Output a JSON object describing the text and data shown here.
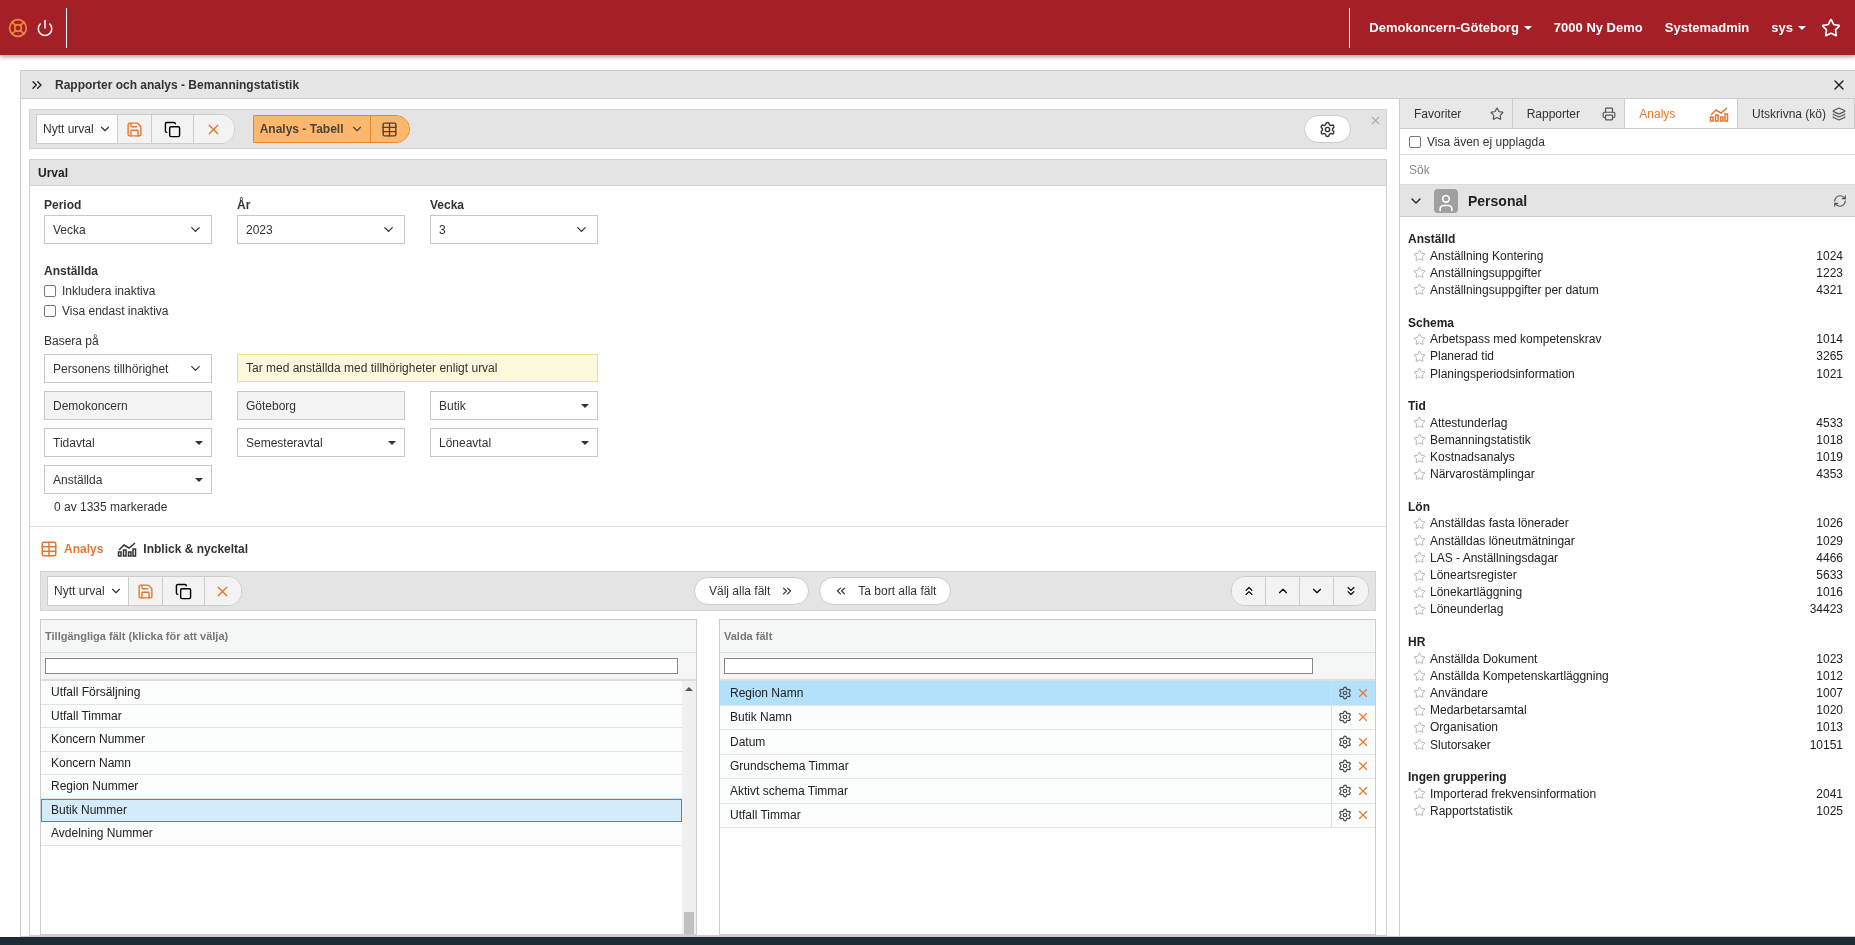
{
  "top_bar": {
    "org_menu": "Demokoncern-Göteborg",
    "company": "7000 Ny Demo",
    "role": "Systemadmin",
    "user_menu": "sys"
  },
  "window": {
    "title": "Rapporter och analys - Bemanningstatistik"
  },
  "toolbar": {
    "selection": "Nytt urval",
    "view_mode": "Analys - Tabell"
  },
  "urval": {
    "title": "Urval",
    "selects": [
      {
        "label": "Period",
        "value": "Vecka"
      },
      {
        "label": "År",
        "value": "2023"
      },
      {
        "label": "Vecka",
        "value": "3"
      }
    ],
    "employees_label": "Anställda",
    "checkboxes": [
      {
        "label": "Inkludera inaktiva",
        "checked": false
      },
      {
        "label": "Visa endast inaktiva",
        "checked": false
      }
    ],
    "base_label": "Basera på",
    "base_value": "Personens tillhörighet",
    "base_hint": "Tar med anställda med tillhörigheter enligt urval",
    "filters": [
      {
        "kind": "readonly",
        "value": "Demokoncern"
      },
      {
        "kind": "readonly",
        "value": "Göteborg"
      },
      {
        "kind": "dropdown",
        "value": "Butik"
      },
      {
        "kind": "dropdown",
        "value": "Tidavtal"
      },
      {
        "kind": "dropdown",
        "value": "Semesteravtal"
      },
      {
        "kind": "dropdown",
        "value": "Löneavtal"
      },
      {
        "kind": "dropdown",
        "value": "Anställda"
      }
    ],
    "selected_count": "0 av 1335 markerade"
  },
  "analysis_tabs": [
    {
      "label": "Analys",
      "selected": true
    },
    {
      "label": "Inblick & nyckeltal",
      "selected": false
    }
  ],
  "field_toolbar": {
    "selection": "Nytt urval",
    "select_all": "Välj alla fält",
    "remove_all": "Ta bort alla fält"
  },
  "available_fields": {
    "header": "Tillgängliga fält (klicka för att välja)",
    "rows": [
      {
        "label": "Utfall Försäljning",
        "selected": false
      },
      {
        "label": "Utfall Timmar",
        "selected": false
      },
      {
        "label": "Koncern Nummer",
        "selected": false
      },
      {
        "label": "Koncern Namn",
        "selected": false
      },
      {
        "label": "Region Nummer",
        "selected": false
      },
      {
        "label": "Butik Nummer",
        "selected": true
      },
      {
        "label": "Avdelning Nummer",
        "selected": false
      }
    ]
  },
  "chosen_fields": {
    "header": "Valda fält",
    "rows": [
      {
        "label": "Region Namn",
        "selected": true
      },
      {
        "label": "Butik Namn",
        "selected": false
      },
      {
        "label": "Datum",
        "selected": false
      },
      {
        "label": "Grundschema Timmar",
        "selected": false
      },
      {
        "label": "Aktivt schema Timmar",
        "selected": false
      },
      {
        "label": "Utfall Timmar",
        "selected": false
      }
    ]
  },
  "side_panel": {
    "tabs": [
      {
        "label": "Favoriter",
        "selected": false
      },
      {
        "label": "Rapporter",
        "selected": false
      },
      {
        "label": "Analys",
        "selected": true
      },
      {
        "label": "Utskrivna (kö)",
        "selected": false
      }
    ],
    "show_unregistered": {
      "label": "Visa även ej upplagda",
      "checked": false
    },
    "search": {
      "placeholder": "Sök"
    },
    "group": {
      "title": "Personal",
      "expanded": true
    },
    "sections": [
      {
        "title": "Anställd",
        "items": [
          {
            "name": "Anställning Kontering",
            "number": "1024"
          },
          {
            "name": "Anställningsuppgifter",
            "number": "1223"
          },
          {
            "name": "Anställningsuppgifter per datum",
            "number": "4321"
          }
        ]
      },
      {
        "title": "Schema",
        "items": [
          {
            "name": "Arbetspass med kompetenskrav",
            "number": "1014"
          },
          {
            "name": "Planerad tid",
            "number": "3265"
          },
          {
            "name": "Planingsperiodsinformation",
            "number": "1021"
          }
        ]
      },
      {
        "title": "Tid",
        "items": [
          {
            "name": "Attestunderlag",
            "number": "4533"
          },
          {
            "name": "Bemanningstatistik",
            "number": "1018"
          },
          {
            "name": "Kostnadsanalys",
            "number": "1019"
          },
          {
            "name": "Närvarostämplingar",
            "number": "4353"
          }
        ]
      },
      {
        "title": "Lön",
        "items": [
          {
            "name": "Anställdas fasta lönerader",
            "number": "1026"
          },
          {
            "name": "Anställdas löneutmätningar",
            "number": "1029"
          },
          {
            "name": "LAS - Anställningsdagar",
            "number": "4466"
          },
          {
            "name": "Löneartsregister",
            "number": "5633"
          },
          {
            "name": "Lönekartläggning",
            "number": "1016"
          },
          {
            "name": "Löneunderlag",
            "number": "34423"
          }
        ]
      },
      {
        "title": "HR",
        "items": [
          {
            "name": "Anställda Dokument",
            "number": "1023"
          },
          {
            "name": "Anställda Kompetenskartläggning",
            "number": "1012"
          },
          {
            "name": "Användare",
            "number": "1007"
          },
          {
            "name": "Medarbetarsamtal",
            "number": "1020"
          },
          {
            "name": "Organisation",
            "number": "1013"
          },
          {
            "name": "Slutorsaker",
            "number": "10151"
          }
        ]
      },
      {
        "title": "Ingen gruppering",
        "items": [
          {
            "name": "Importerad frekvensinformation",
            "number": "2041"
          },
          {
            "name": "Rapportstatistik",
            "number": "1025"
          }
        ]
      }
    ]
  }
}
